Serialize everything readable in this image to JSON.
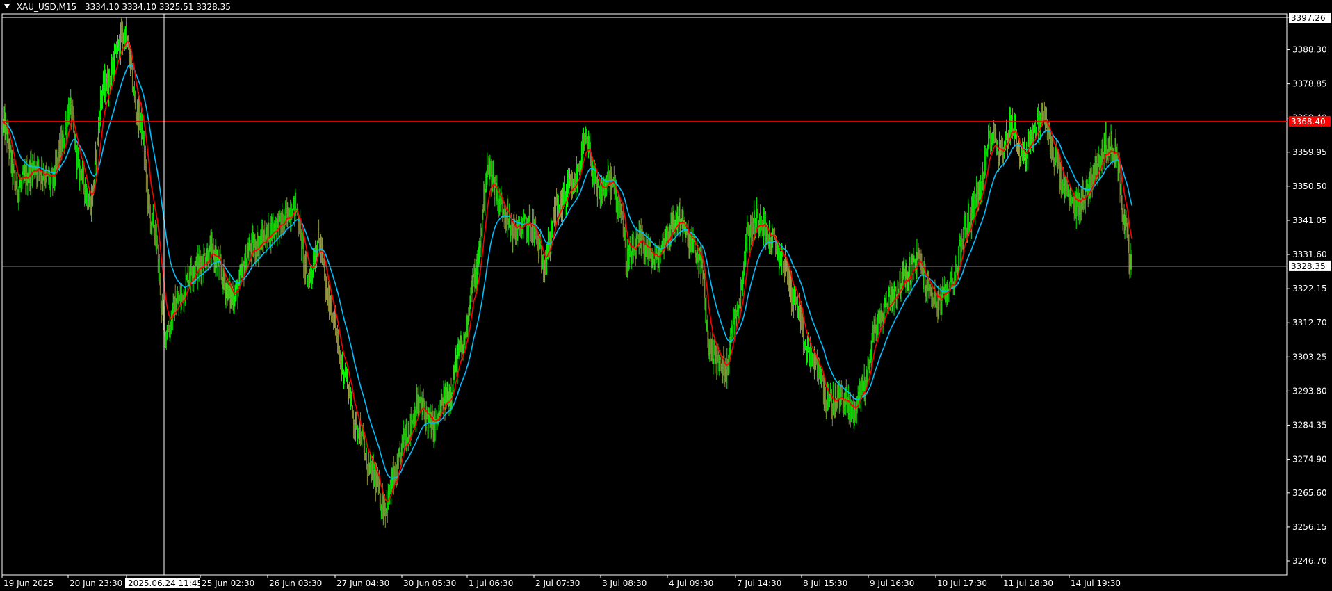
{
  "header": {
    "symbol": "XAU_USD,M15",
    "ohlc": "3334.10 3334.10 3325.51 3328.35"
  },
  "colors": {
    "background": "#000000",
    "frame": "#ffffff",
    "bull_candle": "#00ff00",
    "bear_candle": "#8b8b3a",
    "ma_fast": "#ff0000",
    "ma_slow": "#00bfff",
    "hline": "#ff0000",
    "bid_line": "#a9a9a9",
    "crosshair": "#ffffff"
  },
  "crosshair": {
    "time_label": "2025.06.24 11:45",
    "price_label": "3397.26"
  },
  "chart_data": {
    "type": "candlestick",
    "title": "",
    "xlabel": "",
    "ylabel": "",
    "ylim": [
      3240,
      3400
    ],
    "y_ticks": [
      "3397.26",
      "3388.30",
      "3378.85",
      "3369.40",
      "3359.95",
      "3350.50",
      "3341.05",
      "3331.60",
      "3322.15",
      "3312.70",
      "3303.25",
      "3293.80",
      "3284.35",
      "3274.90",
      "3265.60",
      "3256.15",
      "3246.70"
    ],
    "y_tick_values": [
      3397.26,
      3388.3,
      3378.85,
      3369.4,
      3359.95,
      3350.5,
      3341.05,
      3331.6,
      3322.15,
      3312.7,
      3303.25,
      3293.8,
      3284.35,
      3274.9,
      3265.6,
      3256.15,
      3246.7
    ],
    "x_ticks": [
      "19 Jun 2025",
      "20 Jun 23:30",
      "2025.06.24 11:45",
      "25 Jun 02:30",
      "26 Jun 03:30",
      "27 Jun 04:30",
      "30 Jun 05:30",
      "1 Jul 06:30",
      "2 Jul 07:30",
      "3 Jul 08:30",
      "4 Jul 09:30",
      "7 Jul 14:30",
      "8 Jul 15:30",
      "9 Jul 16:30",
      "10 Jul 17:30",
      "11 Jul 18:30",
      "14 Jul 19:30"
    ],
    "horizontal_level": {
      "value": 3368.4,
      "label": "3368.40"
    },
    "bid": {
      "value": 3328.35,
      "label": "3328.35"
    },
    "price_path_keypoints": [
      [
        0,
        3367
      ],
      [
        20,
        3350
      ],
      [
        45,
        3356
      ],
      [
        70,
        3352
      ],
      [
        85,
        3362
      ],
      [
        95,
        3372
      ],
      [
        110,
        3355
      ],
      [
        125,
        3346
      ],
      [
        145,
        3378
      ],
      [
        175,
        3392
      ],
      [
        195,
        3370
      ],
      [
        215,
        3340
      ],
      [
        235,
        3310
      ],
      [
        250,
        3318
      ],
      [
        275,
        3328
      ],
      [
        300,
        3332
      ],
      [
        330,
        3320
      ],
      [
        360,
        3334
      ],
      [
        400,
        3340
      ],
      [
        420,
        3345
      ],
      [
        440,
        3325
      ],
      [
        455,
        3335
      ],
      [
        470,
        3318
      ],
      [
        490,
        3300
      ],
      [
        510,
        3284
      ],
      [
        530,
        3272
      ],
      [
        550,
        3262
      ],
      [
        565,
        3270
      ],
      [
        580,
        3282
      ],
      [
        600,
        3290
      ],
      [
        620,
        3284
      ],
      [
        640,
        3292
      ],
      [
        660,
        3305
      ],
      [
        680,
        3325
      ],
      [
        700,
        3355
      ],
      [
        720,
        3345
      ],
      [
        735,
        3338
      ],
      [
        760,
        3340
      ],
      [
        780,
        3330
      ],
      [
        800,
        3345
      ],
      [
        820,
        3350
      ],
      [
        840,
        3362
      ],
      [
        860,
        3348
      ],
      [
        875,
        3352
      ],
      [
        890,
        3345
      ],
      [
        900,
        3330
      ],
      [
        920,
        3335
      ],
      [
        940,
        3330
      ],
      [
        960,
        3338
      ],
      [
        975,
        3342
      ],
      [
        990,
        3335
      ],
      [
        1005,
        3330
      ],
      [
        1020,
        3305
      ],
      [
        1040,
        3300
      ],
      [
        1060,
        3318
      ],
      [
        1075,
        3338
      ],
      [
        1090,
        3342
      ],
      [
        1110,
        3335
      ],
      [
        1125,
        3330
      ],
      [
        1140,
        3320
      ],
      [
        1160,
        3305
      ],
      [
        1175,
        3300
      ],
      [
        1190,
        3290
      ],
      [
        1210,
        3292
      ],
      [
        1225,
        3288
      ],
      [
        1240,
        3295
      ],
      [
        1260,
        3312
      ],
      [
        1280,
        3320
      ],
      [
        1300,
        3325
      ],
      [
        1320,
        3330
      ],
      [
        1335,
        3322
      ],
      [
        1350,
        3318
      ],
      [
        1370,
        3325
      ],
      [
        1390,
        3340
      ],
      [
        1410,
        3350
      ],
      [
        1425,
        3365
      ],
      [
        1440,
        3360
      ],
      [
        1455,
        3368
      ],
      [
        1470,
        3358
      ],
      [
        1485,
        3365
      ],
      [
        1500,
        3370
      ],
      [
        1515,
        3360
      ],
      [
        1530,
        3350
      ],
      [
        1545,
        3345
      ],
      [
        1560,
        3348
      ],
      [
        1575,
        3355
      ],
      [
        1590,
        3362
      ],
      [
        1605,
        3360
      ],
      [
        1618,
        3340
      ],
      [
        1628,
        3328
      ]
    ],
    "series": [
      {
        "name": "",
        "role": "fast moving average"
      },
      {
        "name": "",
        "role": "slow moving average"
      }
    ]
  }
}
